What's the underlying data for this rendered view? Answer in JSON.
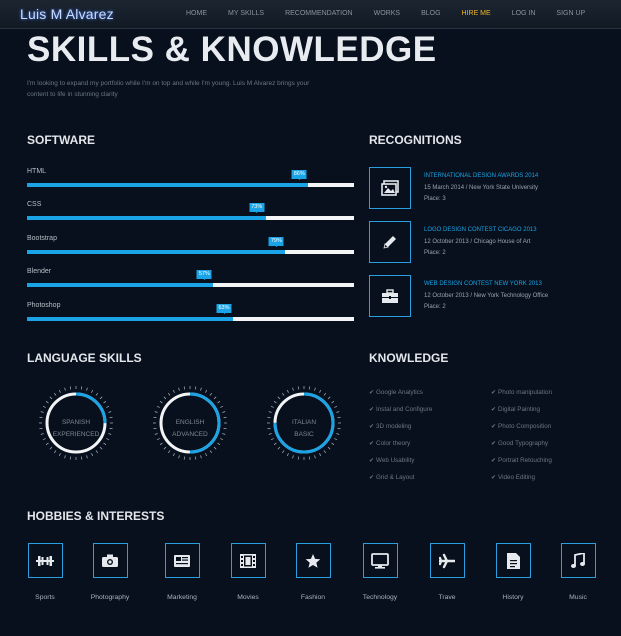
{
  "brand": "Luis M Alvarez",
  "nav": [
    "HOME",
    "MY SKILLS",
    "RECOMMENDATION",
    "WORKS",
    "BLOG",
    "HIRE ME",
    "LOG IN",
    "SIGN UP"
  ],
  "colors": {
    "accent": "#1aa3e6",
    "hire": "#f0b429",
    "bg": "#07101c"
  },
  "page_title": "SKILLS & KNOWLEDGE",
  "intro": "I'm looking to expand my portfolio while I'm on top and while I'm young. Luis M Alvarez brings your content to life in stunning clarity",
  "software": {
    "title": "SOFTWARE",
    "skills": [
      {
        "label": "HTML",
        "percent": 86,
        "badge": "86%"
      },
      {
        "label": "CSS",
        "percent": 73,
        "badge": "73%"
      },
      {
        "label": "Bootstrap",
        "percent": 79,
        "badge": "79%"
      },
      {
        "label": "Blender",
        "percent": 57,
        "badge": "57%"
      },
      {
        "label": "Photoshop",
        "percent": 63,
        "badge": "63%"
      }
    ]
  },
  "recognitions": {
    "title": "RECOGNITIONS",
    "items": [
      {
        "icon": "picture-icon",
        "title": "INTERNATIONAL DESIGN AWARDS 2014",
        "meta": "15 March 2014 / New York State University",
        "place": "Place: 3"
      },
      {
        "icon": "pencil-icon",
        "title": "LOGO DESIGN CONTEST CICAGO 2013",
        "meta": "12 October 2013 / Chicago House of Art",
        "place": "Place: 2"
      },
      {
        "icon": "briefcase-icon",
        "title": "WEB DESIGN CONTEST NEW YORK 2013",
        "meta": "12 October 2013 / New York Technology Office",
        "place": "Place: 2"
      }
    ]
  },
  "languages": {
    "title": "LANGUAGE SKILLS",
    "items": [
      {
        "name": "SPANISH",
        "level": "EXPERIENCED",
        "fraction": 0.25
      },
      {
        "name": "ENGLISH",
        "level": "ADVANCED",
        "fraction": 0.5
      },
      {
        "name": "ITALIAN",
        "level": "BASIC",
        "fraction": 0.75
      }
    ]
  },
  "knowledge": {
    "title": "KNOWLEDGE",
    "col1": [
      "Google Analytics",
      "Instal and Configure",
      "3D modeling",
      "Color theory",
      "Web Usability",
      "Grid & Layout"
    ],
    "col2": [
      "Photo manipulation",
      "Digital Painting",
      "Photo Composition",
      "Good Typography",
      "Portrait Retouching",
      "Video Editing"
    ]
  },
  "hobbies": {
    "title": "HOBBIES & INTERESTS",
    "items": [
      {
        "label": "Sports",
        "icon": "dumbbell-icon"
      },
      {
        "label": "Photography",
        "icon": "camera-icon"
      },
      {
        "label": "Marketing",
        "icon": "newspaper-icon"
      },
      {
        "label": "Movies",
        "icon": "film-icon"
      },
      {
        "label": "Fashion",
        "icon": "star-icon"
      },
      {
        "label": "Technology",
        "icon": "monitor-icon"
      },
      {
        "label": "Trave",
        "icon": "plane-icon"
      },
      {
        "label": "History",
        "icon": "document-icon"
      },
      {
        "label": "Music",
        "icon": "music-icon"
      }
    ]
  }
}
